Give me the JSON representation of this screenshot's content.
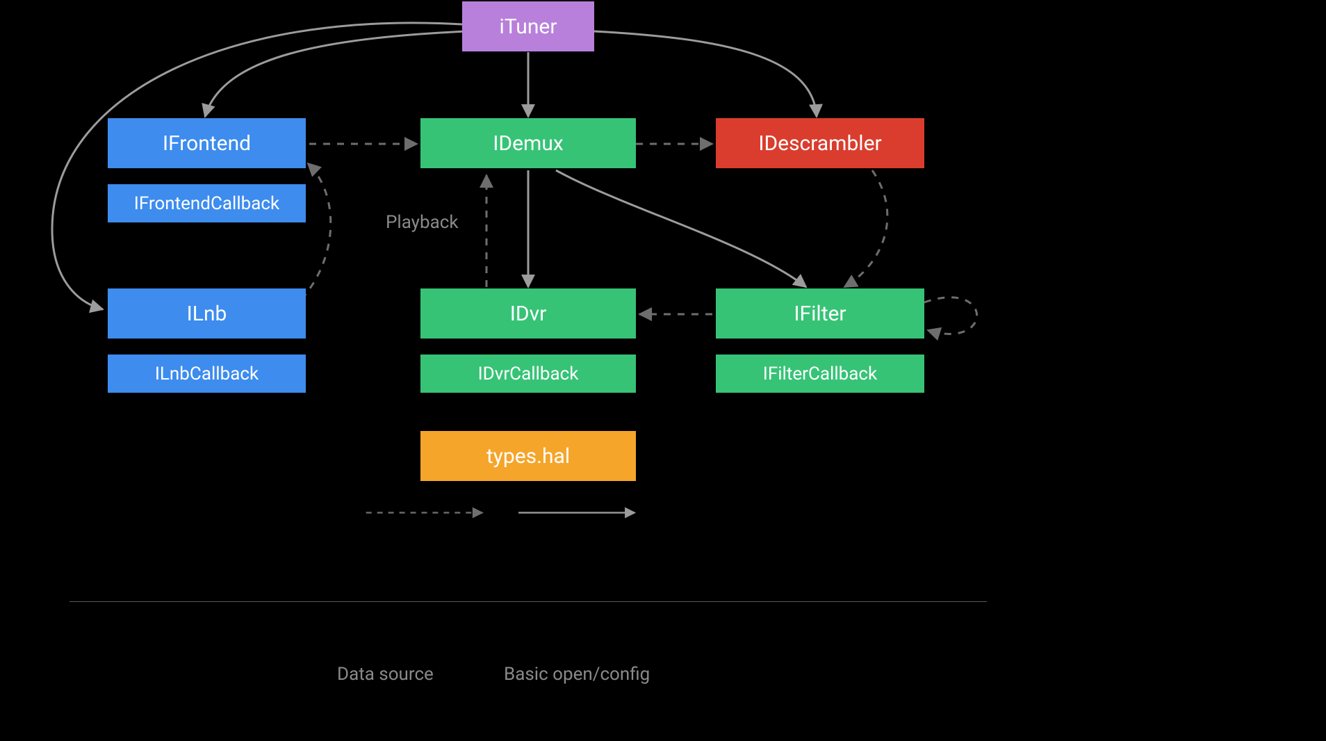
{
  "nodes": {
    "ituner": "iTuner",
    "ifrontend": "IFrontend",
    "ifrontend_cb": "IFrontendCallback",
    "ilnb": "ILnb",
    "ilnb_cb": "ILnbCallback",
    "idemux": "IDemux",
    "idvr": "IDvr",
    "idvr_cb": "IDvrCallback",
    "ifilter": "IFilter",
    "ifilter_cb": "IFilterCallback",
    "idescrambler": "IDescrambler",
    "types_hal": "types.hal"
  },
  "annotations": {
    "playback": "Playback"
  },
  "legend": {
    "dashed": "Data source",
    "solid": "Basic open/config"
  }
}
